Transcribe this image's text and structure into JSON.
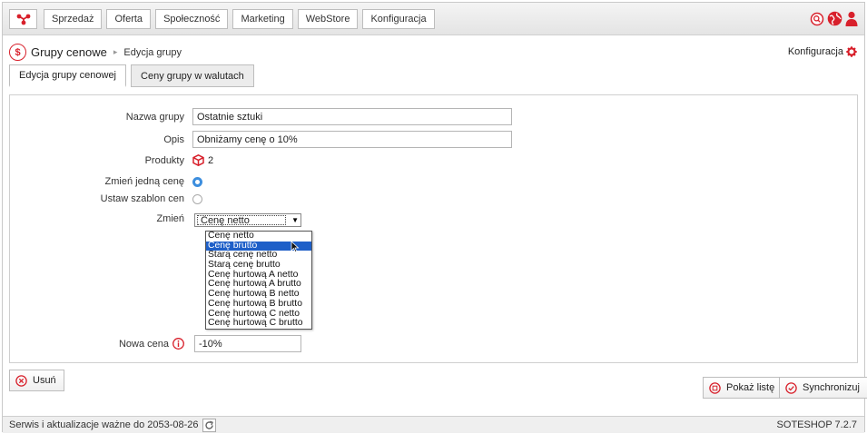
{
  "topbar": {
    "nav": [
      "Sprzedaż",
      "Oferta",
      "Społeczność",
      "Marketing",
      "WebStore",
      "Konfiguracja"
    ],
    "brand_color": "#d8202b"
  },
  "breadcrumb": {
    "title": "Grupy cenowe",
    "separator": "▸",
    "current": "Edycja grupy"
  },
  "config_link": "Konfiguracja",
  "tabs": [
    "Edycja grupy cenowej",
    "Ceny grupy w walutach"
  ],
  "form": {
    "name_label": "Nazwa grupy",
    "name_value": "Ostatnie sztuki",
    "desc_label": "Opis",
    "desc_value": "Obniżamy cenę o 10%",
    "products_label": "Produkty",
    "products_count": "2",
    "change_one_label": "Zmień jedną cenę",
    "change_one_checked": true,
    "template_label": "Ustaw szablon cen",
    "template_checked": false,
    "change_label": "Zmień",
    "change_selected": "Cenę netto",
    "change_options": [
      "Cenę netto",
      "Cenę brutto",
      "Starą cenę netto",
      "Starą cenę brutto",
      "Cenę hurtową A netto",
      "Cenę hurtową A brutto",
      "Cenę hurtową B netto",
      "Cenę hurtową B brutto",
      "Cenę hurtową C netto",
      "Cenę hurtową C brutto"
    ],
    "highlighted_option": "Cenę brutto",
    "new_price_label": "Nowa cena",
    "new_price_value": "-10%"
  },
  "buttons": {
    "delete": "Usuń",
    "show_list": "Pokaż listę",
    "sync": "Synchronizuj"
  },
  "status": {
    "service": "Serwis i aktualizacje ważne do 2053-08-26",
    "version": "SOTESHOP 7.2.7"
  },
  "colors": {
    "accent": "#d8202b",
    "radio": "#3d8ede",
    "selection": "#1e5fc8"
  }
}
